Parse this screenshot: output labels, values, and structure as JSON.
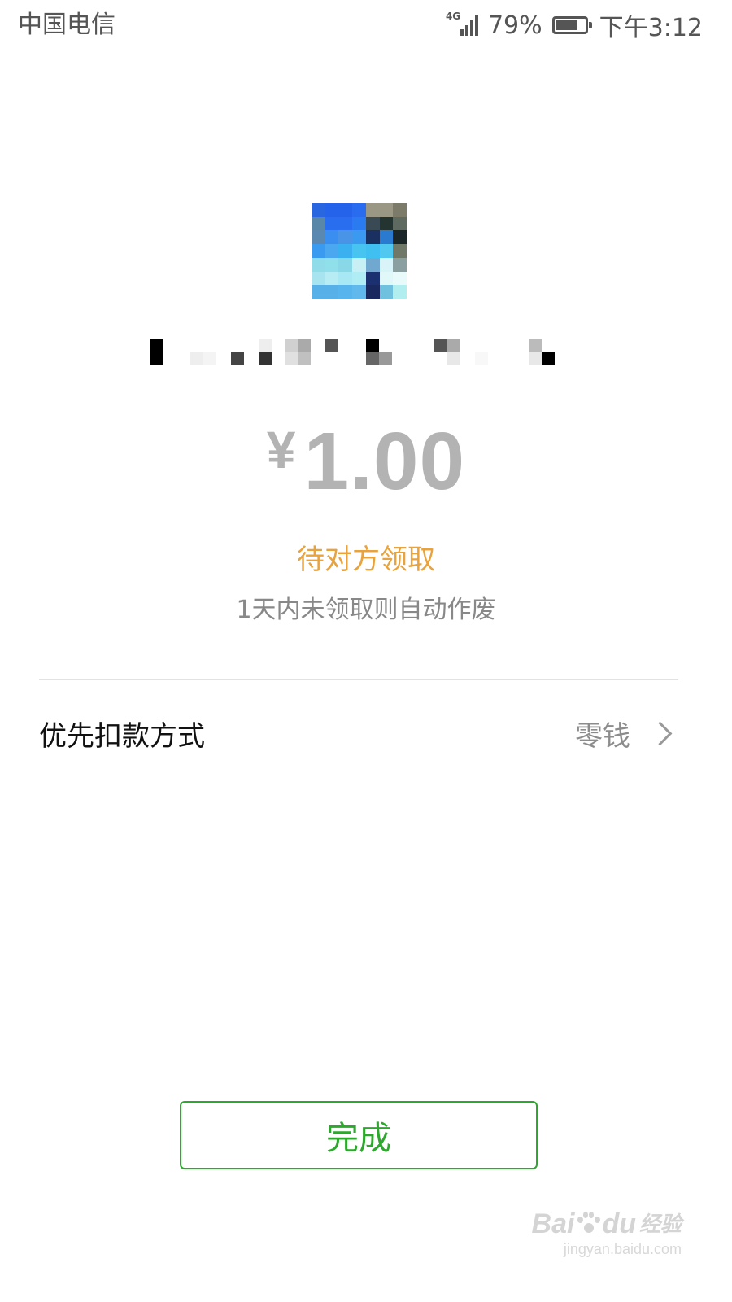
{
  "status_bar": {
    "carrier": "中国电信",
    "network": "4G",
    "battery": "79%",
    "battery_level": 0.79,
    "time": "下午3:12"
  },
  "transfer": {
    "amount_currency": "¥",
    "amount_value": "1.00",
    "status": "待对方领取",
    "expire_note": "1天内未领取则自动作废"
  },
  "payment_method": {
    "label": "优先扣款方式",
    "value": "零钱"
  },
  "actions": {
    "done_label": "完成"
  },
  "watermark": {
    "logo_left": "Bai",
    "logo_right": "du",
    "logo_suffix": "经验",
    "url": "jingyan.baidu.com"
  },
  "colors": {
    "accent_green": "#2ca82c",
    "status_orange": "#e8a33d",
    "amount_gray": "#b3b3b3"
  }
}
